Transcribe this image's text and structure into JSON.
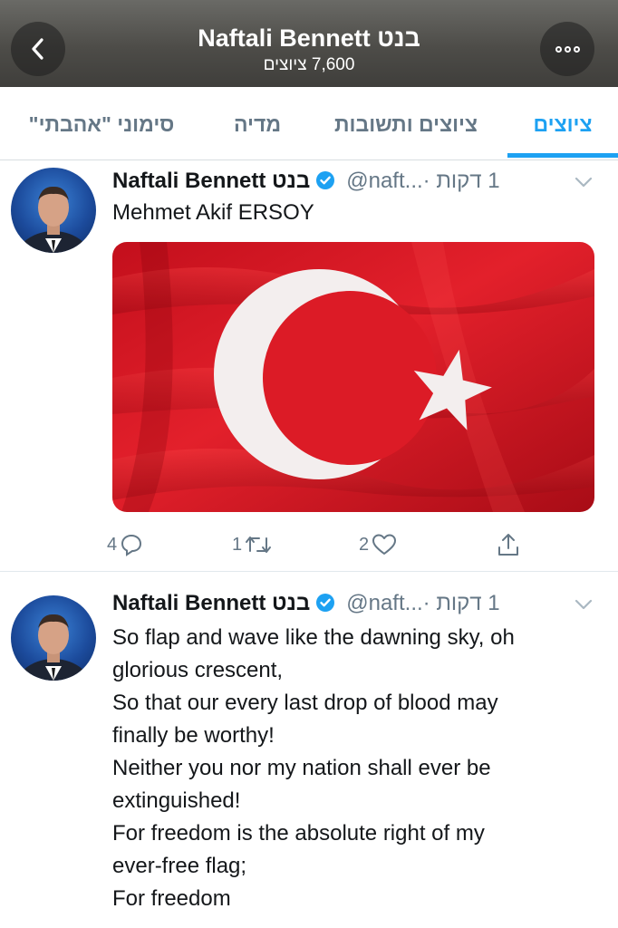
{
  "header": {
    "title": "Naftali Bennett בנט",
    "subtitle": "7,600 ציוצים",
    "back_icon": "chevron-left-icon",
    "more_icon": "more-options-icon"
  },
  "tabs": [
    {
      "label": "ציוצים",
      "active": true
    },
    {
      "label": "ציוצים ותשובות",
      "active": false
    },
    {
      "label": "מדיה",
      "active": false
    },
    {
      "label": "סימוני \"אהבתי\"",
      "active": false
    }
  ],
  "colors": {
    "accent": "#1da1f2",
    "header_bg": "#4d4c48",
    "muted": "#657786",
    "flag_red": "#d8101e"
  },
  "tweets": [
    {
      "name": "Naftali Bennett בנט",
      "handle": "@naft...",
      "time": "1 דקות ·",
      "verified": true,
      "text": [
        "Mehmet Akif ERSOY"
      ],
      "media": "turkish-flag-image",
      "replies": "4",
      "retweets": "1",
      "likes": "2"
    },
    {
      "name": "Naftali Bennett בנט",
      "handle": "@naft...",
      "time": "1 דקות ·",
      "verified": true,
      "text": [
        "So flap and wave like the dawning sky, oh",
        "glorious crescent,",
        "So that our every last drop of blood may",
        "finally be worthy!",
        "Neither you nor my nation shall ever be",
        "extinguished!",
        "For freedom is the absolute right of my",
        "ever-free flag;",
        "For freedom"
      ]
    }
  ]
}
